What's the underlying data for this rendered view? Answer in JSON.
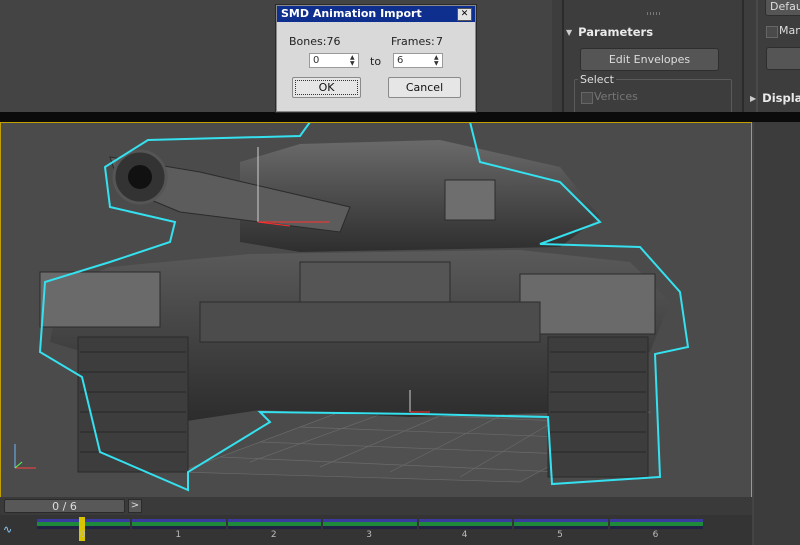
{
  "dialog": {
    "title": "SMD Animation Import",
    "close_glyph": "✕",
    "bones_text": "Bones:76",
    "frames_label": "Frames:",
    "frames_value": "7",
    "start_value": "0",
    "to_label": "to",
    "end_value": "6",
    "ok_label": "OK",
    "cancel_label": "Cancel"
  },
  "command_panel": {
    "parameters_title": "Parameters",
    "edit_envelopes_label": "Edit Envelopes",
    "select_label": "Select",
    "vertices_label": "Vertices",
    "default_label": "Defau",
    "manage_label": "Man",
    "display_title": "Displa"
  },
  "timeline": {
    "frame_display": "0 / 6",
    "next_glyph": ">",
    "ticks": [
      "0",
      "1",
      "2",
      "3",
      "4",
      "5",
      "6"
    ],
    "current_frame": 0,
    "total_frames": 6
  },
  "colors": {
    "dialog_title_bg": "#0f2f8e",
    "viewport_border": "#c2a000",
    "selection_outline": "#35e0ef",
    "track_green": "#1c8a3a",
    "track_blue": "#3a3aa0"
  },
  "icons": {
    "rollout_arrow": "triangle-down-icon",
    "display_arrow": "triangle-right-icon",
    "trackbar_icon": "curve-editor-icon"
  }
}
